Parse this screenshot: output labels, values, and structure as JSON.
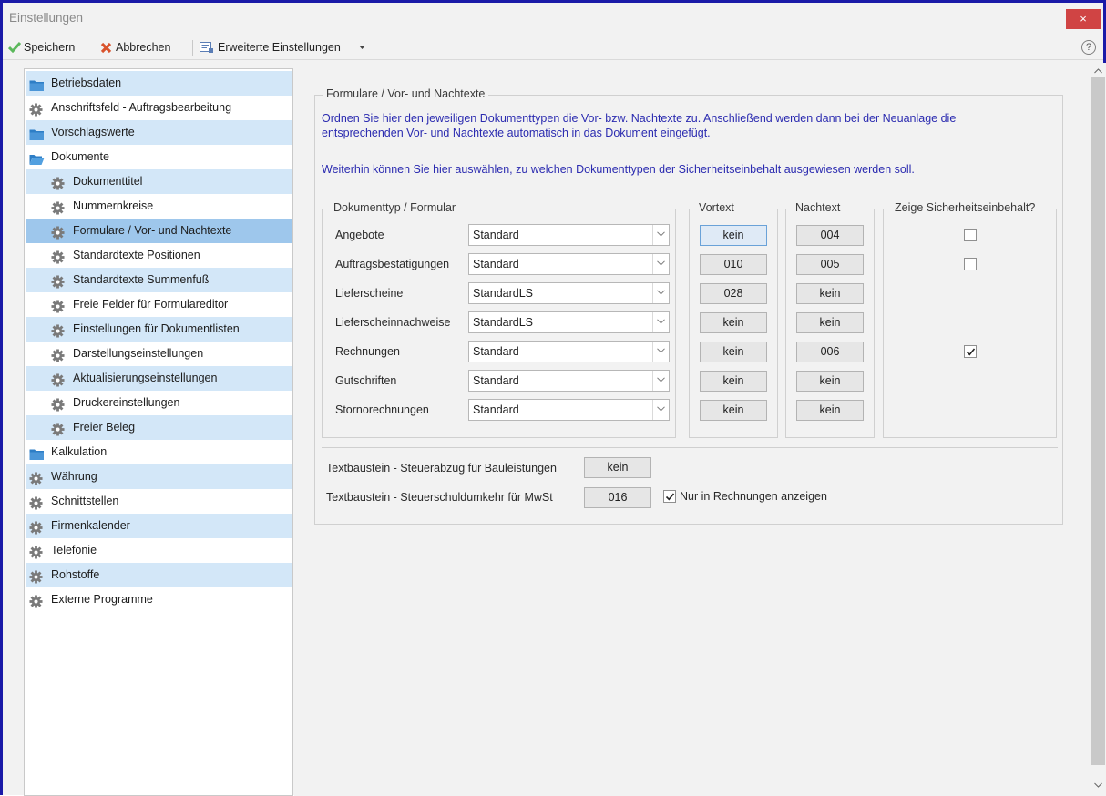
{
  "window": {
    "title": "Einstellungen",
    "close_glyph": "×"
  },
  "toolbar": {
    "save_label": "Speichern",
    "cancel_label": "Abbrechen",
    "advanced_label": "Erweiterte Einstellungen",
    "help_glyph": "?"
  },
  "sidebar": {
    "items": [
      {
        "label": "Betriebsdaten",
        "icon": "folder-icon"
      },
      {
        "label": "Anschriftsfeld - Auftragsbearbeitung",
        "icon": "gear-icon"
      },
      {
        "label": "Vorschlagswerte",
        "icon": "folder-icon"
      },
      {
        "label": "Dokumente",
        "icon": "folder-open-icon"
      },
      {
        "label": "Dokumenttitel",
        "icon": "gear-icon"
      },
      {
        "label": "Nummernkreise",
        "icon": "gear-icon"
      },
      {
        "label": "Formulare / Vor- und Nachtexte",
        "icon": "gear-icon"
      },
      {
        "label": "Standardtexte Positionen",
        "icon": "gear-icon"
      },
      {
        "label": "Standardtexte Summenfuß",
        "icon": "gear-icon"
      },
      {
        "label": "Freie Felder für Formulareditor",
        "icon": "gear-icon"
      },
      {
        "label": "Einstellungen für Dokumentlisten",
        "icon": "gear-icon"
      },
      {
        "label": "Darstellungseinstellungen",
        "icon": "gear-icon"
      },
      {
        "label": "Aktualisierungseinstellungen",
        "icon": "gear-icon"
      },
      {
        "label": "Druckereinstellungen",
        "icon": "gear-icon"
      },
      {
        "label": "Freier Beleg",
        "icon": "gear-icon"
      },
      {
        "label": "Kalkulation",
        "icon": "folder-icon"
      },
      {
        "label": "Währung",
        "icon": "gear-icon"
      },
      {
        "label": "Schnittstellen",
        "icon": "gear-icon"
      },
      {
        "label": "Firmenkalender",
        "icon": "gear-icon"
      },
      {
        "label": "Telefonie",
        "icon": "gear-icon"
      },
      {
        "label": "Rohstoffe",
        "icon": "gear-icon"
      },
      {
        "label": "Externe Programme",
        "icon": "gear-icon"
      }
    ],
    "selected": "Formulare / Vor- und Nachtexte"
  },
  "main": {
    "group_title": "Formulare / Vor- und Nachtexte",
    "intro_line1": "Ordnen Sie hier den jeweiligen Dokumenttypen die Vor- bzw. Nachtexte zu. Anschließend werden dann bei der Neuanlage die",
    "intro_line2": "entsprechenden Vor- und Nachtexte automatisch in das Dokument eingefügt.",
    "intro_line3": "Weiterhin können Sie hier auswählen, zu welchen Dokumenttypen der Sicherheitseinbehalt ausgewiesen werden soll.",
    "col_doc": "Dokumenttyp / Formular",
    "col_vortext": "Vortext",
    "col_nachtext": "Nachtext",
    "col_sicherheit": "Zeige Sicherheitseinbehalt?",
    "rows": [
      {
        "label": "Angebote",
        "formular": "Standard",
        "vortext": "kein",
        "nachtext": "004",
        "sicherheit": "unchecked"
      },
      {
        "label": "Auftragsbestätigungen",
        "formular": "Standard",
        "vortext": "010",
        "nachtext": "005",
        "sicherheit": "unchecked"
      },
      {
        "label": "Lieferscheine",
        "formular": "StandardLS",
        "vortext": "028",
        "nachtext": "kein",
        "sicherheit": "none"
      },
      {
        "label": "Lieferscheinnachweise",
        "formular": "StandardLS",
        "vortext": "kein",
        "nachtext": "kein",
        "sicherheit": "none"
      },
      {
        "label": "Rechnungen",
        "formular": "Standard",
        "vortext": "kein",
        "nachtext": "006",
        "sicherheit": "checked"
      },
      {
        "label": "Gutschriften",
        "formular": "Standard",
        "vortext": "kein",
        "nachtext": "kein",
        "sicherheit": "none"
      },
      {
        "label": "Stornorechnungen",
        "formular": "Standard",
        "vortext": "kein",
        "nachtext": "kein",
        "sicherheit": "none"
      }
    ],
    "textbaustein1_label": "Textbaustein - Steuerabzug für Bauleistungen",
    "textbaustein1_value": "kein",
    "textbaustein2_label": "Textbaustein - Steuerschuldumkehr für MwSt",
    "textbaustein2_value": "016",
    "nur_rechnungen_label": "Nur in Rechnungen anzeigen",
    "nur_rechnungen_checked": true
  },
  "colors": {
    "accent_blue_text": "#2b2bb0",
    "nav_band": "#d3e7f8",
    "nav_selected": "#9ec7ec",
    "close_red": "#d04444",
    "save_green": "#4caf50",
    "cancel_red": "#d9532c"
  }
}
